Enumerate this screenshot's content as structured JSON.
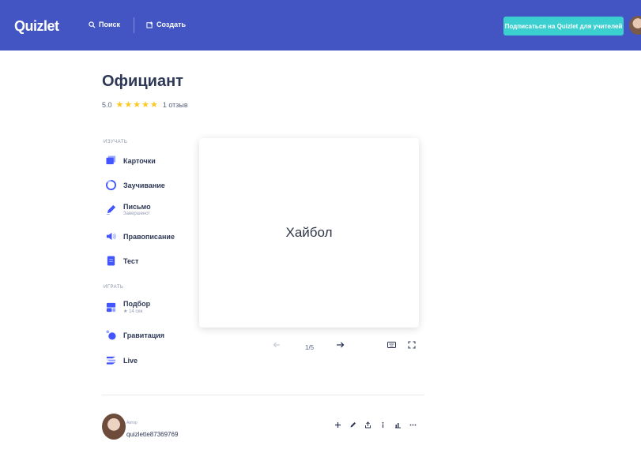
{
  "header": {
    "logo": "Quizlet",
    "search_label": "Поиск",
    "create_label": "Создать",
    "cta_label": "Подписаться на Quizlet для учителей"
  },
  "set": {
    "title": "Официант",
    "rating_value": "5.0",
    "stars": "★★★★★",
    "reviews": "1 отзыв"
  },
  "study": {
    "section_label": "ИЗУЧАТЬ",
    "modes": [
      {
        "label": "Карточки",
        "sub": ""
      },
      {
        "label": "Заучивание",
        "sub": ""
      },
      {
        "label": "Письмо",
        "sub": "Завершено!"
      },
      {
        "label": "Правописание",
        "sub": ""
      },
      {
        "label": "Тест",
        "sub": ""
      }
    ]
  },
  "play": {
    "section_label": "ИГРАТЬ",
    "modes": [
      {
        "label": "Подбор",
        "sub": "★ 14 сек"
      },
      {
        "label": "Гравитация",
        "sub": ""
      },
      {
        "label": "Live",
        "sub": ""
      }
    ]
  },
  "card": {
    "term": "Хайбол",
    "counter": "1/5"
  },
  "author": {
    "role": "Автор",
    "name": "quizlette87369769"
  },
  "colors": {
    "header_bg": "#4255c2",
    "cta_bg": "#3ccfcf",
    "star": "#ffc81e",
    "icon_blue": "#4255ff"
  },
  "icons": {
    "search": "search-icon",
    "create": "create-icon",
    "prev": "arrow-left-icon",
    "next": "arrow-right-icon",
    "keyboard": "keyboard-icon",
    "fullscreen": "fullscreen-icon",
    "add": "plus-icon",
    "edit": "pencil-icon",
    "share": "share-icon",
    "info": "info-icon",
    "stats": "bar-chart-icon",
    "more": "more-icon"
  }
}
